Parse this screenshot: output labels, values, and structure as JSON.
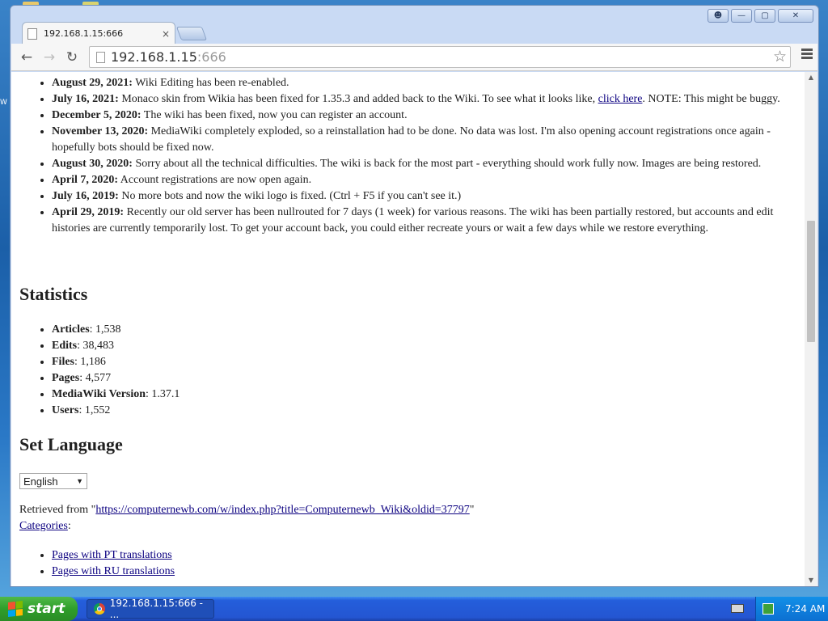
{
  "browser": {
    "tab_title": "192.168.1.15:666",
    "tab_close": "×",
    "url_host": "192.168.1.15",
    "url_port": ":666"
  },
  "news": [
    {
      "date": "August 29, 2021:",
      "text": " Wiki Editing has been re-enabled."
    },
    {
      "date": "July 16, 2021:",
      "text_before": " Monaco skin from Wikia has been fixed for 1.35.3 and added back to the Wiki. To see what it looks like, ",
      "link": "click here",
      "text_after": ". NOTE: This might be buggy."
    },
    {
      "date": "December 5, 2020:",
      "text": " The wiki has been fixed, now you can register an account."
    },
    {
      "date": "November 13, 2020:",
      "text": " MediaWiki completely exploded, so a reinstallation had to be done. No data was lost. I'm also opening account registrations once again - hopefully bots should be fixed now."
    },
    {
      "date": "August 30, 2020:",
      "text": " Sorry about all the technical difficulties. The wiki is back for the most part - everything should work fully now. Images are being restored."
    },
    {
      "date": "April 7, 2020:",
      "text": " Account registrations are now open again."
    },
    {
      "date": "July 16, 2019:",
      "text": " No more bots and now the wiki logo is fixed. (Ctrl + F5 if you can't see it.)"
    },
    {
      "date": "April 29, 2019:",
      "text": " Recently our old server has been nullrouted for 7 days (1 week) for various reasons. The wiki has been partially restored, but accounts and edit histories are currently temporarily lost. To get your account back, you could either recreate yours or wait a few days while we restore everything."
    }
  ],
  "statistics": {
    "heading": "Statistics",
    "items": [
      {
        "label": "Articles",
        "value": ": 1,538"
      },
      {
        "label": "Edits",
        "value": ": 38,483"
      },
      {
        "label": "Files",
        "value": ": 1,186"
      },
      {
        "label": "Pages",
        "value": ": 4,577"
      },
      {
        "label": "MediaWiki Version",
        "value": ": 1.37.1"
      },
      {
        "label": "Users",
        "value": ": 1,552"
      }
    ]
  },
  "language": {
    "heading": "Set Language",
    "selected": "English"
  },
  "footer": {
    "retrieved_prefix": "Retrieved from \"",
    "retrieved_link": "https://computernewb.com/w/index.php?title=Computernewb_Wiki&oldid=37797",
    "retrieved_suffix": "\"",
    "categories_link": "Categories",
    "categories_colon": ":",
    "category_items": [
      "Pages with PT translations",
      "Pages with RU translations"
    ]
  },
  "taskbar": {
    "start_label": "start",
    "task_label": "192.168.1.15:666 - ...",
    "clock": "7:24 AM"
  },
  "desktop": {
    "partial_label": "W"
  },
  "colors": {
    "link": "#0b0080",
    "desktop": "#1b5fa8",
    "taskbar": "#245edb",
    "start": "#2f9e2a"
  }
}
